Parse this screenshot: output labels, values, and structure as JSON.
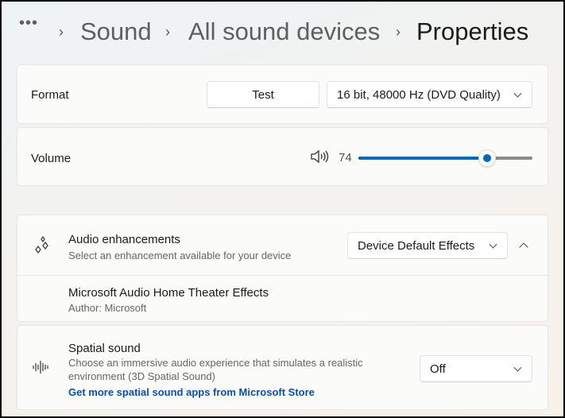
{
  "breadcrumb": {
    "more": "•••",
    "items": [
      "Sound",
      "All sound devices"
    ],
    "current": "Properties"
  },
  "format": {
    "label": "Format",
    "test_label": "Test",
    "selected": "16 bit, 48000 Hz (DVD Quality)"
  },
  "volume": {
    "label": "Volume",
    "value": "74",
    "level": 74,
    "accent": "#0067c0"
  },
  "enhancements": {
    "title": "Audio enhancements",
    "subtitle": "Select an enhancement available for your device",
    "selected": "Device Default Effects",
    "effect_name": "Microsoft Audio Home Theater Effects",
    "effect_author": "Author: Microsoft"
  },
  "spatial": {
    "title": "Spatial sound",
    "description_line1": "Choose an immersive audio experience that simulates a realistic",
    "description_line2": "environment (3D Spatial Sound)",
    "link": "Get more spatial sound apps from Microsoft Store",
    "selected": "Off"
  }
}
